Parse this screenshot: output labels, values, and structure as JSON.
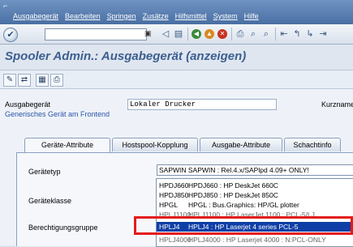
{
  "menu": [
    "Ausgabegerät",
    "Bearbeiten",
    "Springen",
    "Zusätze",
    "Hilfsmittel",
    "System",
    "Hilfe"
  ],
  "toolbar": {
    "command_value": ""
  },
  "title": "Spooler Admin.: Ausgabegerät (anzeigen)",
  "form": {
    "device_label": "Ausgabegerät",
    "device_value": "Lokaler Drucker",
    "short_label": "Kurzname",
    "generic_link": "Generisches Gerät am Frontend"
  },
  "tabs": [
    "Geräte-Attribute",
    "Hostspool-Kopplung",
    "Ausgabe-Attribute",
    "Schachtinfo"
  ],
  "active_tab": "Geräte-Attribute",
  "panel": {
    "type_label": "Gerätetyp",
    "type_value": "SAPWIN SAPWIN : Rel.4.x/SAPlpd 4.09+ ONLY!",
    "class_label": "Geräteklasse",
    "auth_label": "Berechtigungsgruppe"
  },
  "dropdown": [
    {
      "code": "HPDJ660",
      "desc": "HPDJ660 : HP DeskJet 660C"
    },
    {
      "code": "HPDJ850",
      "desc": "HPDJ850 : HP DeskJet 850C"
    },
    {
      "code": "HPGL",
      "desc": "HPGL : Bus.Graphics: HP/GL plotter"
    },
    {
      "code": "HPLJ1100",
      "desc": "HPLJ1100 : HP LaserJet 1100 : PCL-5/LJ"
    },
    {
      "code": "HPLJ4",
      "desc": "HPLJ4 : HP Laserjet 4 series PCL-5"
    },
    {
      "code": "HPLJ4000",
      "desc": "HPLJ4000 : HP Laserjet 4000 : N:PCL-ONLY"
    }
  ],
  "selected_index": 4,
  "colors": {
    "selection": "#0f3fa6",
    "highlight": "#e41b1b",
    "title": "#3d5f8f"
  }
}
